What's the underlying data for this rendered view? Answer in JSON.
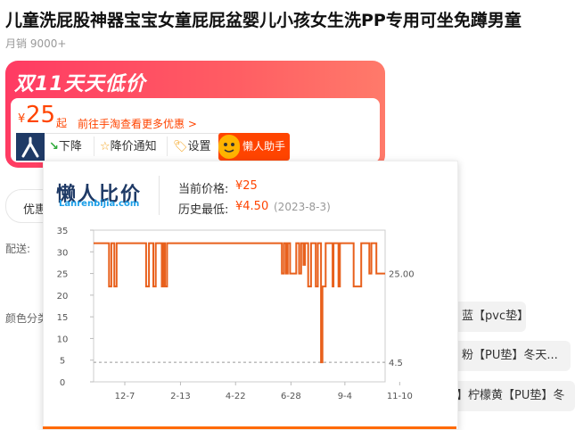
{
  "product": {
    "title": "儿童洗屁股神器宝宝女童屁屁盆婴儿小孩女生洗PP专用可坐免蹲男童",
    "sales": "月销 9000+"
  },
  "promo": {
    "banner": "双11天天低价",
    "currency": "¥",
    "price": "25",
    "price_unit": "起",
    "link": "前往手淘查看更多优惠 >"
  },
  "toolbar": {
    "down_label": "下降",
    "notify_label": "降价通知",
    "settings_label": "设置",
    "assistant_label": "懒人助手"
  },
  "panel": {
    "logo": "懒人比价",
    "logo_sub": "Lanrenbijia.com",
    "current_label": "当前价格:",
    "current_value": "¥25",
    "lowest_label": "历史最低:",
    "lowest_value": "¥4.50",
    "lowest_date": "(2023-8-3)"
  },
  "background": {
    "coupon_label": "优惠",
    "ship_label": "配送:",
    "color_label": "颜色分类",
    "options": [
      "蓝【pvc垫】",
      "粉【PU垫】冬天...",
      "】柠檬黄【PU垫】冬"
    ]
  },
  "colors": {
    "accent": "#ff4400",
    "brand_navy": "#1f3a66",
    "line": "#e8601c"
  },
  "chart_data": {
    "type": "line",
    "y_ticks": [
      0,
      5,
      10,
      15,
      20,
      25,
      30,
      35
    ],
    "ylim": [
      0,
      35
    ],
    "x_tick_labels": [
      "12-7",
      "2-13",
      "4-22",
      "6-28",
      "9-4",
      "11-10"
    ],
    "x_tick_positions": [
      0.107,
      0.298,
      0.487,
      0.677,
      0.862,
      1.05
    ],
    "annotations": [
      {
        "label": "25.00",
        "value": 25
      },
      {
        "label": "4.5",
        "value": 4.5
      }
    ],
    "series": [
      {
        "points": [
          [
            0,
            32
          ],
          [
            0.053,
            32
          ],
          [
            0.053,
            22
          ],
          [
            0.061,
            22
          ],
          [
            0.061,
            32
          ],
          [
            0.071,
            32
          ],
          [
            0.071,
            22
          ],
          [
            0.079,
            22
          ],
          [
            0.079,
            32
          ],
          [
            0.18,
            32
          ],
          [
            0.18,
            22
          ],
          [
            0.19,
            22
          ],
          [
            0.19,
            32
          ],
          [
            0.205,
            32
          ],
          [
            0.205,
            22
          ],
          [
            0.213,
            22
          ],
          [
            0.213,
            32
          ],
          [
            0.234,
            32
          ],
          [
            0.234,
            22
          ],
          [
            0.24,
            22
          ],
          [
            0.24,
            32
          ],
          [
            0.245,
            32
          ],
          [
            0.245,
            22
          ],
          [
            0.252,
            22
          ],
          [
            0.252,
            32
          ],
          [
            0.646,
            32
          ],
          [
            0.646,
            25
          ],
          [
            0.653,
            25
          ],
          [
            0.653,
            32
          ],
          [
            0.66,
            32
          ],
          [
            0.66,
            25
          ],
          [
            0.666,
            25
          ],
          [
            0.666,
            32
          ],
          [
            0.674,
            32
          ],
          [
            0.674,
            25
          ],
          [
            0.695,
            25
          ],
          [
            0.695,
            32
          ],
          [
            0.705,
            32
          ],
          [
            0.705,
            25
          ],
          [
            0.712,
            25
          ],
          [
            0.712,
            32
          ],
          [
            0.72,
            32
          ],
          [
            0.72,
            27
          ],
          [
            0.725,
            27
          ],
          [
            0.725,
            32
          ],
          [
            0.736,
            32
          ],
          [
            0.736,
            22
          ],
          [
            0.746,
            22
          ],
          [
            0.746,
            32
          ],
          [
            0.762,
            32
          ],
          [
            0.762,
            22
          ],
          [
            0.769,
            22
          ],
          [
            0.769,
            32
          ],
          [
            0.78,
            32
          ],
          [
            0.78,
            4.5
          ],
          [
            0.785,
            4.5
          ],
          [
            0.785,
            22
          ],
          [
            0.796,
            22
          ],
          [
            0.796,
            32
          ],
          [
            0.82,
            32
          ],
          [
            0.82,
            22
          ],
          [
            0.823,
            22
          ],
          [
            0.823,
            32
          ],
          [
            0.84,
            32
          ],
          [
            0.84,
            22
          ],
          [
            0.845,
            22
          ],
          [
            0.845,
            32
          ],
          [
            0.892,
            32
          ],
          [
            0.892,
            22
          ],
          [
            0.918,
            22
          ],
          [
            0.918,
            32
          ],
          [
            0.946,
            32
          ],
          [
            0.946,
            25
          ],
          [
            0.953,
            25
          ],
          [
            0.953,
            32
          ],
          [
            0.97,
            32
          ],
          [
            0.97,
            25
          ],
          [
            1.0,
            25
          ]
        ]
      }
    ]
  }
}
